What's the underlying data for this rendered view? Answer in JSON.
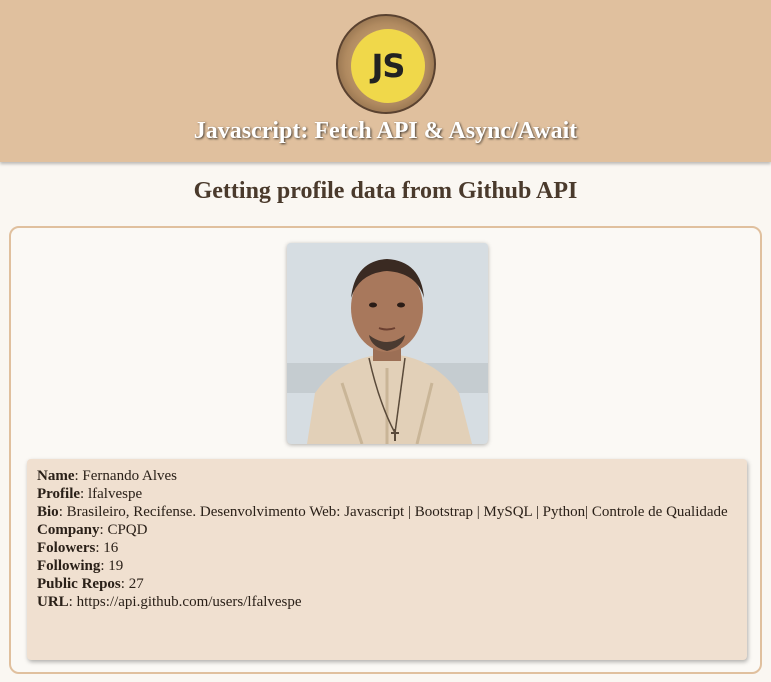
{
  "header": {
    "logo_text": "JS",
    "title": "Javascript: Fetch API & Async/Await"
  },
  "subtitle": "Getting profile data from Github API",
  "profile": {
    "fields": [
      {
        "label": "Name",
        "value": "Fernando Alves"
      },
      {
        "label": "Profile",
        "value": "lfalvespe"
      },
      {
        "label": "Bio",
        "value": "Brasileiro, Recifense. Desenvolvimento Web: Javascript | Bootstrap | MySQL | Python| Controle de Qualidade"
      },
      {
        "label": "Company",
        "value": "CPQD"
      },
      {
        "label": "Folowers",
        "value": "16"
      },
      {
        "label": "Following",
        "value": "19"
      },
      {
        "label": "Public Repos",
        "value": "27"
      },
      {
        "label": "URL",
        "value": "https://api.github.com/users/lfalvespe"
      }
    ]
  },
  "colors": {
    "header_bg": "#e0c09e",
    "info_bg": "#f0e0d0",
    "logo_yellow": "#f0d84a"
  }
}
